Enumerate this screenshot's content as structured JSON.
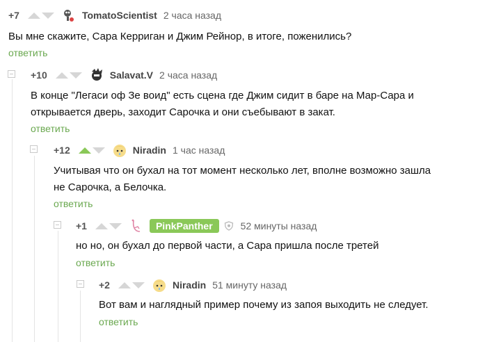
{
  "comments": [
    {
      "rating": "+7",
      "username": "TomatoScientist",
      "time": "2 часа назад",
      "text": "Вы мне скажите, Сара Керриган и Джим Рейнор, в итоге, поженились?",
      "reply": "ответить"
    },
    {
      "rating": "+10",
      "username": "Salavat.V",
      "time": "2 часа назад",
      "text": "В конце \"Легаси оф Зе воид\" есть сцена где Джим сидит в баре на Мар-Сара и открывается дверь, заходит Сарочка и они съебывают в закат.",
      "reply": "ответить"
    },
    {
      "rating": "+12",
      "username": "Niradin",
      "time": "1 час назад",
      "text": "Учитывая что он бухал на тот момент несколько лет, вполне возможно зашла не Сарочка, а Белочка.",
      "reply": "ответить"
    },
    {
      "rating": "+1",
      "username": "PinkPanther",
      "time": "52 минуты назад",
      "text": "но но, он бухал до первой части, а Сара пришла после третей",
      "reply": "ответить"
    },
    {
      "rating": "+2",
      "username": "Niradin",
      "time": "51 минуту назад",
      "text": "Вот вам и наглядный пример почему из запоя выходить не следует.",
      "reply": "ответить"
    }
  ],
  "colors": {
    "accent_green": "#8ac858",
    "reply_green": "#6aa84f",
    "vote_inactive": "#d6d6d6"
  }
}
